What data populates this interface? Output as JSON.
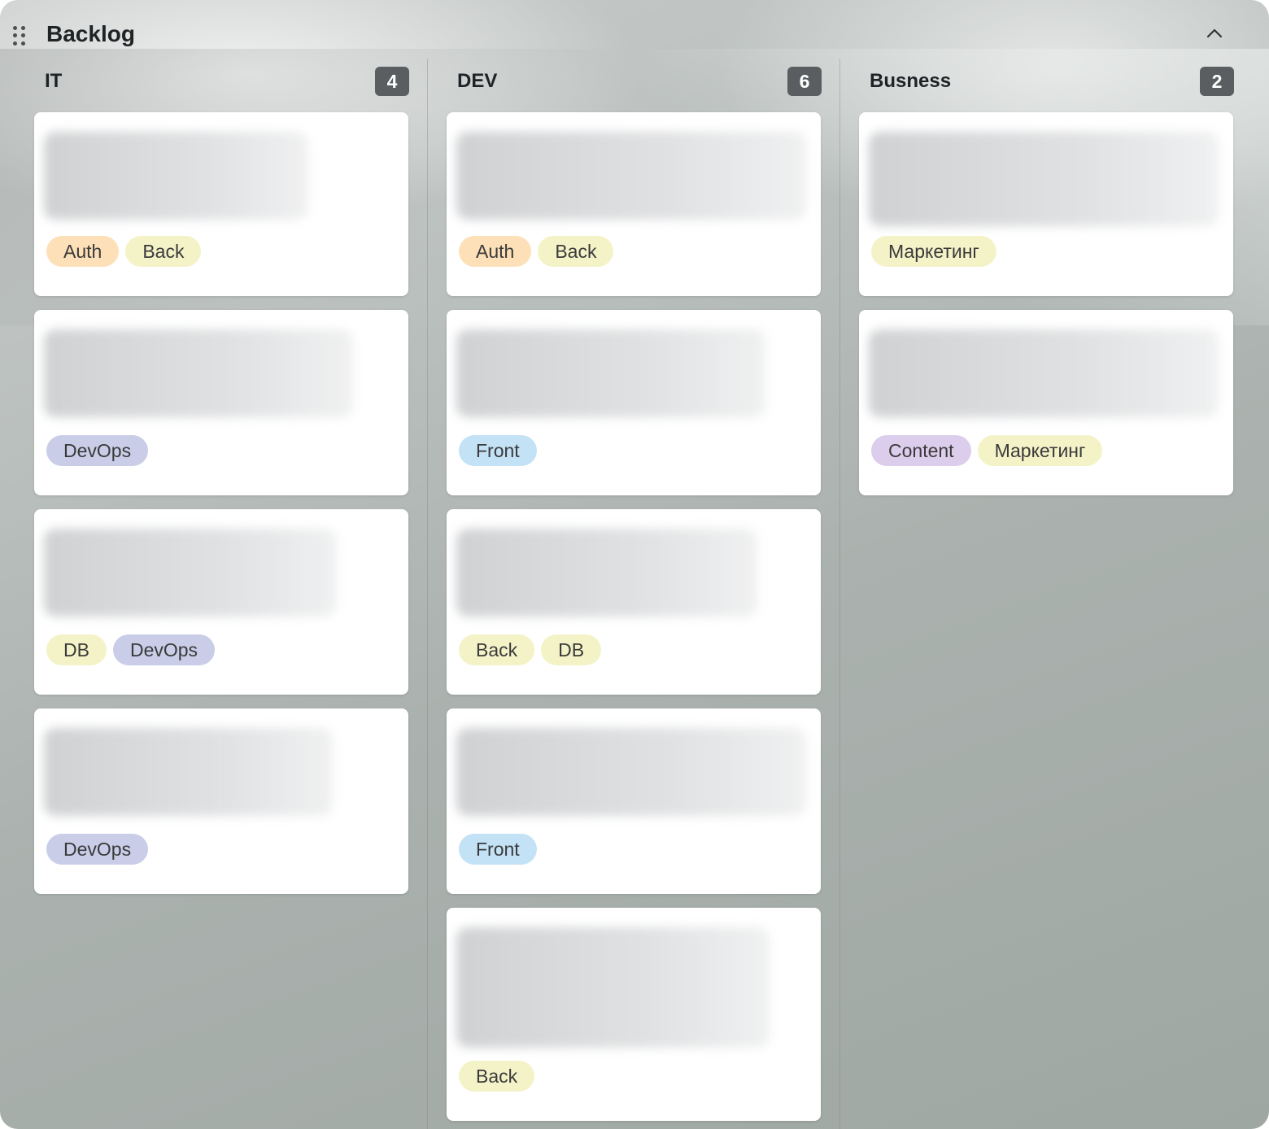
{
  "board": {
    "title": "Backlog",
    "columns": [
      {
        "name": "IT",
        "count": "4",
        "cards": [
          {
            "tags": [
              {
                "label": "Auth",
                "type": "auth"
              },
              {
                "label": "Back",
                "type": "back"
              }
            ]
          },
          {
            "tags": [
              {
                "label": "DevOps",
                "type": "devops"
              }
            ]
          },
          {
            "tags": [
              {
                "label": "DB",
                "type": "db"
              },
              {
                "label": "DevOps",
                "type": "devops"
              }
            ]
          },
          {
            "tags": [
              {
                "label": "DevOps",
                "type": "devops"
              }
            ]
          }
        ]
      },
      {
        "name": "DEV",
        "count": "6",
        "cards": [
          {
            "tags": [
              {
                "label": "Auth",
                "type": "auth"
              },
              {
                "label": "Back",
                "type": "back"
              }
            ]
          },
          {
            "tags": [
              {
                "label": "Front",
                "type": "front"
              }
            ]
          },
          {
            "tags": [
              {
                "label": "Back",
                "type": "back"
              },
              {
                "label": "DB",
                "type": "db"
              }
            ]
          },
          {
            "tags": [
              {
                "label": "Front",
                "type": "front"
              }
            ]
          },
          {
            "tags": [
              {
                "label": "Back",
                "type": "back"
              }
            ]
          }
        ]
      },
      {
        "name": "Busness",
        "count": "2",
        "cards": [
          {
            "tags": [
              {
                "label": "Маркетинг",
                "type": "mkt"
              }
            ]
          },
          {
            "tags": [
              {
                "label": "Content",
                "type": "content"
              },
              {
                "label": "Маркетинг",
                "type": "mkt"
              }
            ]
          }
        ]
      }
    ]
  },
  "icons": {
    "drag": "drag-handle-icon",
    "collapse": "chevron-up-icon"
  },
  "colors": {
    "count_badge": "#5a5e61",
    "auth": "#fde0b8",
    "back": "#f4f3c8",
    "db": "#f4f3c8",
    "devops": "#c9cde8",
    "front": "#c4e2f6",
    "content": "#dccdec",
    "mkt": "#f4f3c8"
  }
}
